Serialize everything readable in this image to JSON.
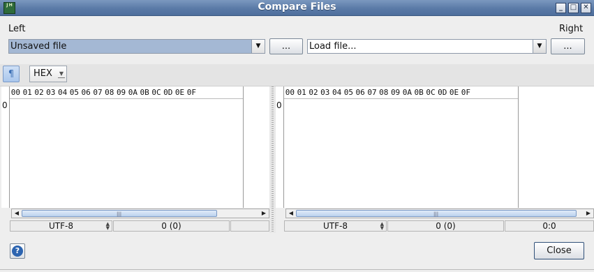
{
  "window": {
    "title": "Compare Files",
    "app_icon_text": "J H",
    "controls": {
      "minimize": "_",
      "maximize": "□",
      "close": "✕"
    }
  },
  "left": {
    "label": "Left",
    "file_combo_value": "Unsaved file",
    "browse_label": "...",
    "encoding": "UTF-8",
    "position": "0 (0)",
    "extra_status": "",
    "row_offset": "0"
  },
  "right": {
    "label": "Right",
    "file_combo_value": "Load file...",
    "browse_label": "...",
    "encoding": "UTF-8",
    "position": "0 (0)",
    "extra_status": "0:0",
    "row_offset": "0"
  },
  "toolbar": {
    "pilcrow_icon": "¶",
    "view_mode": "HEX"
  },
  "hex_header": [
    "00",
    "01",
    "02",
    "03",
    "04",
    "05",
    "06",
    "07",
    "08",
    "09",
    "0A",
    "0B",
    "0C",
    "0D",
    "0E",
    "0F"
  ],
  "footer": {
    "help_icon": "?",
    "close_label": "Close"
  },
  "colors": {
    "title_bar": "#5a7aa7",
    "selected_combo": "#a4b8d4",
    "accent": "#2c64b0"
  }
}
